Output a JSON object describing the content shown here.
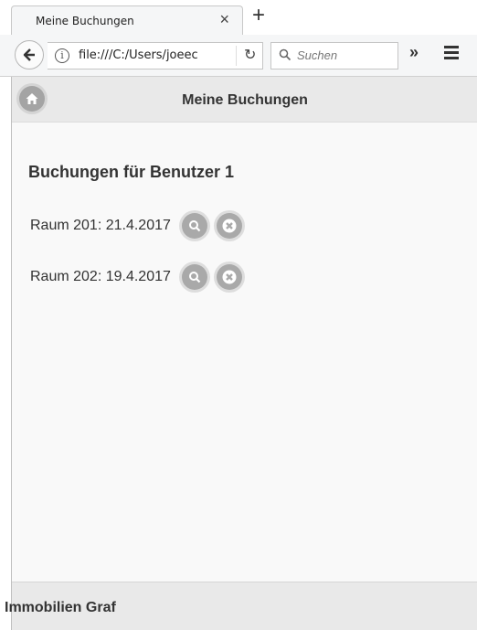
{
  "browser": {
    "tab_title": "Meine Buchungen",
    "url": "file:///C:/Users/joeec",
    "search_placeholder": "Suchen"
  },
  "app": {
    "header_title": "Meine Buchungen",
    "section_heading": "Buchungen für Benutzer 1",
    "bookings": [
      {
        "label": "Raum 201: 21.4.2017"
      },
      {
        "label": "Raum 202: 19.4.2017"
      }
    ],
    "footer": "Immobilien Graf"
  },
  "icons": {
    "home": "home-icon",
    "view": "search-icon",
    "delete": "delete-icon"
  },
  "colors": {
    "header_bg": "#e9e9e9",
    "page_bg": "#f9f9f9",
    "icon_button": "#a9a9a9",
    "text": "#333333"
  }
}
